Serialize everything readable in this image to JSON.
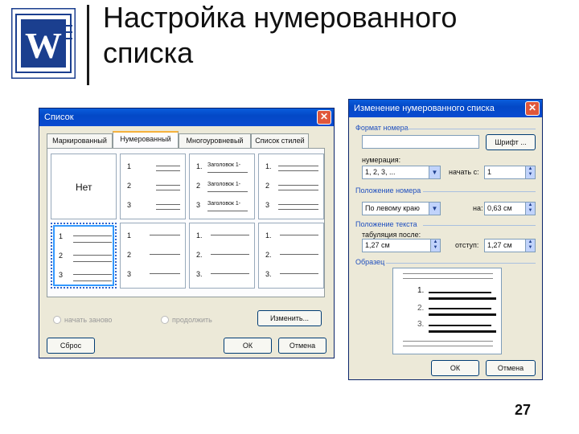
{
  "slide": {
    "title_line1": "Настройка нумерованного",
    "title_line2": "списка",
    "page_number": "27"
  },
  "list_dialog": {
    "title": "Список",
    "tabs": [
      "Маркированный",
      "Нумерованный",
      "Многоуровневый",
      "Список стилей"
    ],
    "none_label": "Нет",
    "heading_text": "Заголовок 1-",
    "restart_label": "начать заново",
    "continue_label": "продолжить",
    "modify_button": "Изменить...",
    "reset_button": "Сброс",
    "ok_button": "ОК",
    "cancel_button": "Отмена",
    "close": "✕"
  },
  "modify_dialog": {
    "title": "Изменение нумерованного списка",
    "number_format_label": "Формат номера",
    "font_button": "Шрифт ...",
    "numbering_label": "нумерация:",
    "numbering_value": "1, 2, 3, ...",
    "start_at_label": "начать с:",
    "start_at_value": "1",
    "number_position_label": "Положение номера",
    "alignment_value": "По левому краю",
    "at_label": "на:",
    "at_value": "0,63 см",
    "text_position_label": "Положение текста",
    "tab_after_label": "табуляция после:",
    "tab_after_value": "1,27 см",
    "indent_label": "отступ:",
    "indent_value": "1,27 см",
    "sample_label": "Образец",
    "sample_numbers": [
      "1.",
      "2.",
      "3."
    ],
    "ok_button": "ОК",
    "cancel_button": "Отмена",
    "close": "✕"
  }
}
